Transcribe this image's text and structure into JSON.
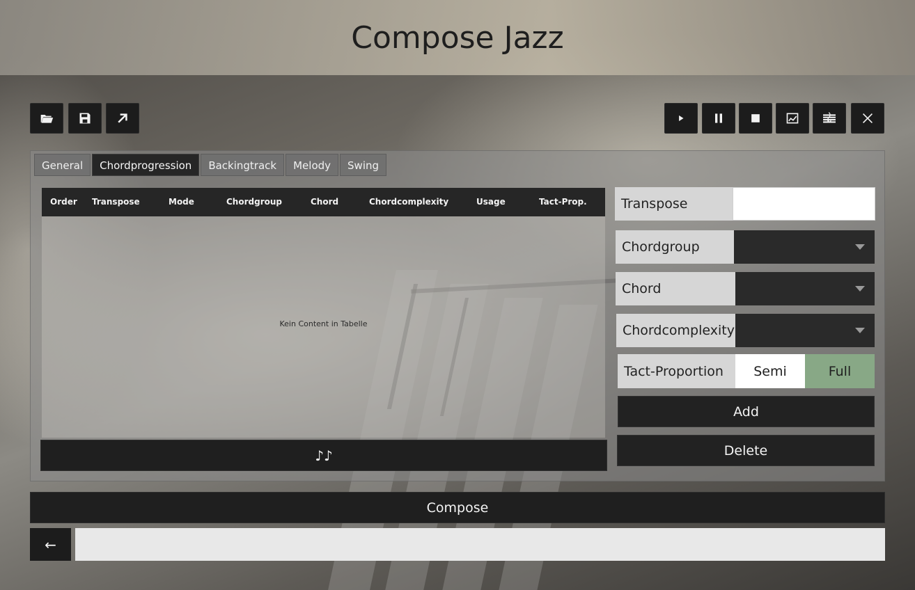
{
  "app": {
    "title": "Compose Jazz"
  },
  "toolbar_left": [
    {
      "name": "open-folder",
      "icon": "folder-open-icon"
    },
    {
      "name": "save",
      "icon": "floppy-disk-icon"
    },
    {
      "name": "export",
      "icon": "arrow-up-right-icon"
    }
  ],
  "toolbar_right": [
    {
      "name": "play",
      "icon": "play-icon"
    },
    {
      "name": "pause",
      "icon": "pause-icon"
    },
    {
      "name": "stop",
      "icon": "stop-icon"
    },
    {
      "name": "chart",
      "icon": "line-chart-icon"
    },
    {
      "name": "score",
      "icon": "music-score-icon"
    },
    {
      "name": "close",
      "icon": "close-icon"
    }
  ],
  "tabs": [
    {
      "label": "General",
      "active": false
    },
    {
      "label": "Chordprogression",
      "active": true
    },
    {
      "label": "Backingtrack",
      "active": false
    },
    {
      "label": "Melody",
      "active": false
    },
    {
      "label": "Swing",
      "active": false
    }
  ],
  "table": {
    "columns": [
      "Order",
      "Transpose",
      "Mode",
      "Chordgroup",
      "Chord",
      "Chordcomplexity",
      "Usage",
      "Tact-Prop."
    ],
    "rows": [],
    "empty_message": "Kein Content in Tabelle"
  },
  "music_button_icon": "music-notes-icon",
  "form": {
    "transpose": {
      "label": "Transpose",
      "value": ""
    },
    "chordgroup": {
      "label": "Chordgroup",
      "value": ""
    },
    "chord": {
      "label": "Chord",
      "value": ""
    },
    "chordcomplexity": {
      "label": "Chordcomplexity",
      "value": ""
    },
    "tact_proportion": {
      "label": "Tact-Proportion",
      "options": [
        "Semi",
        "Full"
      ],
      "selected": "Full"
    },
    "add_label": "Add",
    "delete_label": "Delete"
  },
  "compose_label": "Compose",
  "back_label": "←",
  "status_text": "",
  "colors": {
    "selected_toggle": "#88a886",
    "dark_button": "#1f1f1f"
  }
}
